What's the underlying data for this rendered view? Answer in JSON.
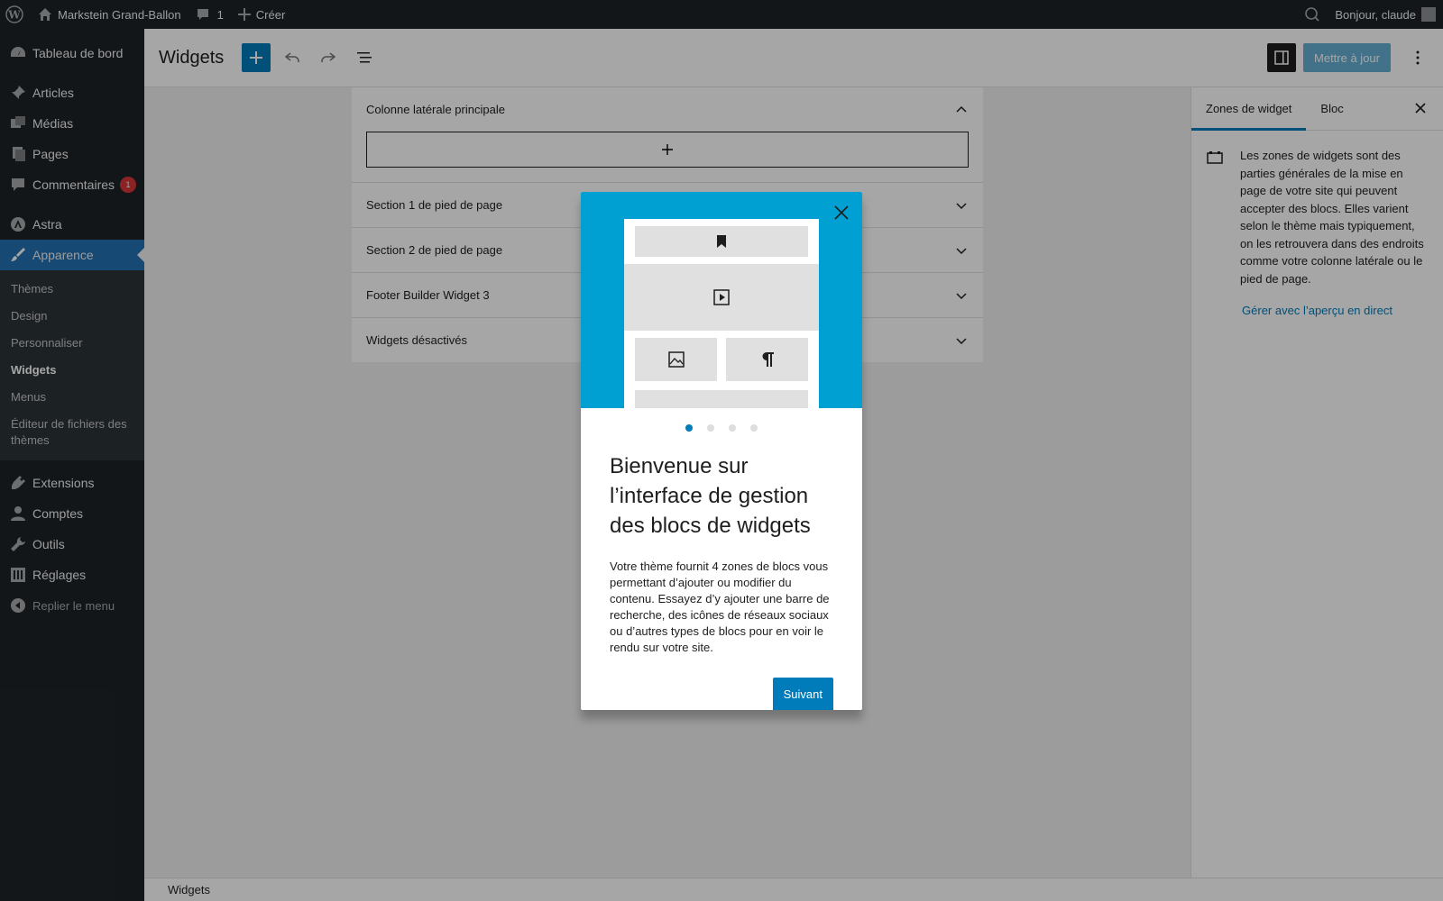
{
  "adminbar": {
    "site_name": "Markstein Grand-Ballon",
    "comments_count": "1",
    "new_label": "Créer",
    "greeting": "Bonjour, claude"
  },
  "menu": {
    "dashboard": "Tableau de bord",
    "posts": "Articles",
    "media": "Médias",
    "pages": "Pages",
    "comments": "Commentaires",
    "comments_badge": "1",
    "astra": "Astra",
    "appearance": "Apparence",
    "submenu": {
      "themes": "Thèmes",
      "design": "Design",
      "customize": "Personnaliser",
      "widgets": "Widgets",
      "menus": "Menus",
      "theme_editor": "Éditeur de fichiers des thèmes"
    },
    "plugins": "Extensions",
    "users": "Comptes",
    "tools": "Outils",
    "settings": "Réglages",
    "collapse": "Replier le menu"
  },
  "header": {
    "title": "Widgets",
    "update_label": "Mettre à jour"
  },
  "widget_areas": [
    {
      "label": "Colonne latérale principale"
    },
    {
      "label": "Section 1 de pied de page"
    },
    {
      "label": "Section 2 de pied de page"
    },
    {
      "label": "Footer Builder Widget 3"
    },
    {
      "label": "Widgets désactivés"
    }
  ],
  "sidebar": {
    "tab_areas": "Zones de widget",
    "tab_block": "Bloc",
    "description": "Les zones de widgets sont des parties générales de la mise en page de votre site qui peuvent accepter des blocs. Elles varient selon le thème mais typiquement, on les retrouvera dans des endroits comme votre colonne latérale ou le pied de page.",
    "link": "Gérer avec l’aperçu en direct"
  },
  "statusbar": {
    "breadcrumb": "Widgets"
  },
  "guide": {
    "title": "Bienvenue sur l’interface de gestion des blocs de widgets",
    "text": "Votre thème fournit 4 zones de blocs vous permettant d’ajouter ou modifier du contenu. Essayez d’y ajouter une barre de recherche, des icônes de réseaux sociaux ou d’autres types de blocs pour en voir le rendu sur votre site.",
    "next_label": "Suivant",
    "current_page": 1,
    "page_count": 4
  },
  "colors": {
    "accent": "#007cba",
    "admin_dark": "#1d2327",
    "guide_bg": "#00a0d2",
    "badge": "#d63638"
  }
}
